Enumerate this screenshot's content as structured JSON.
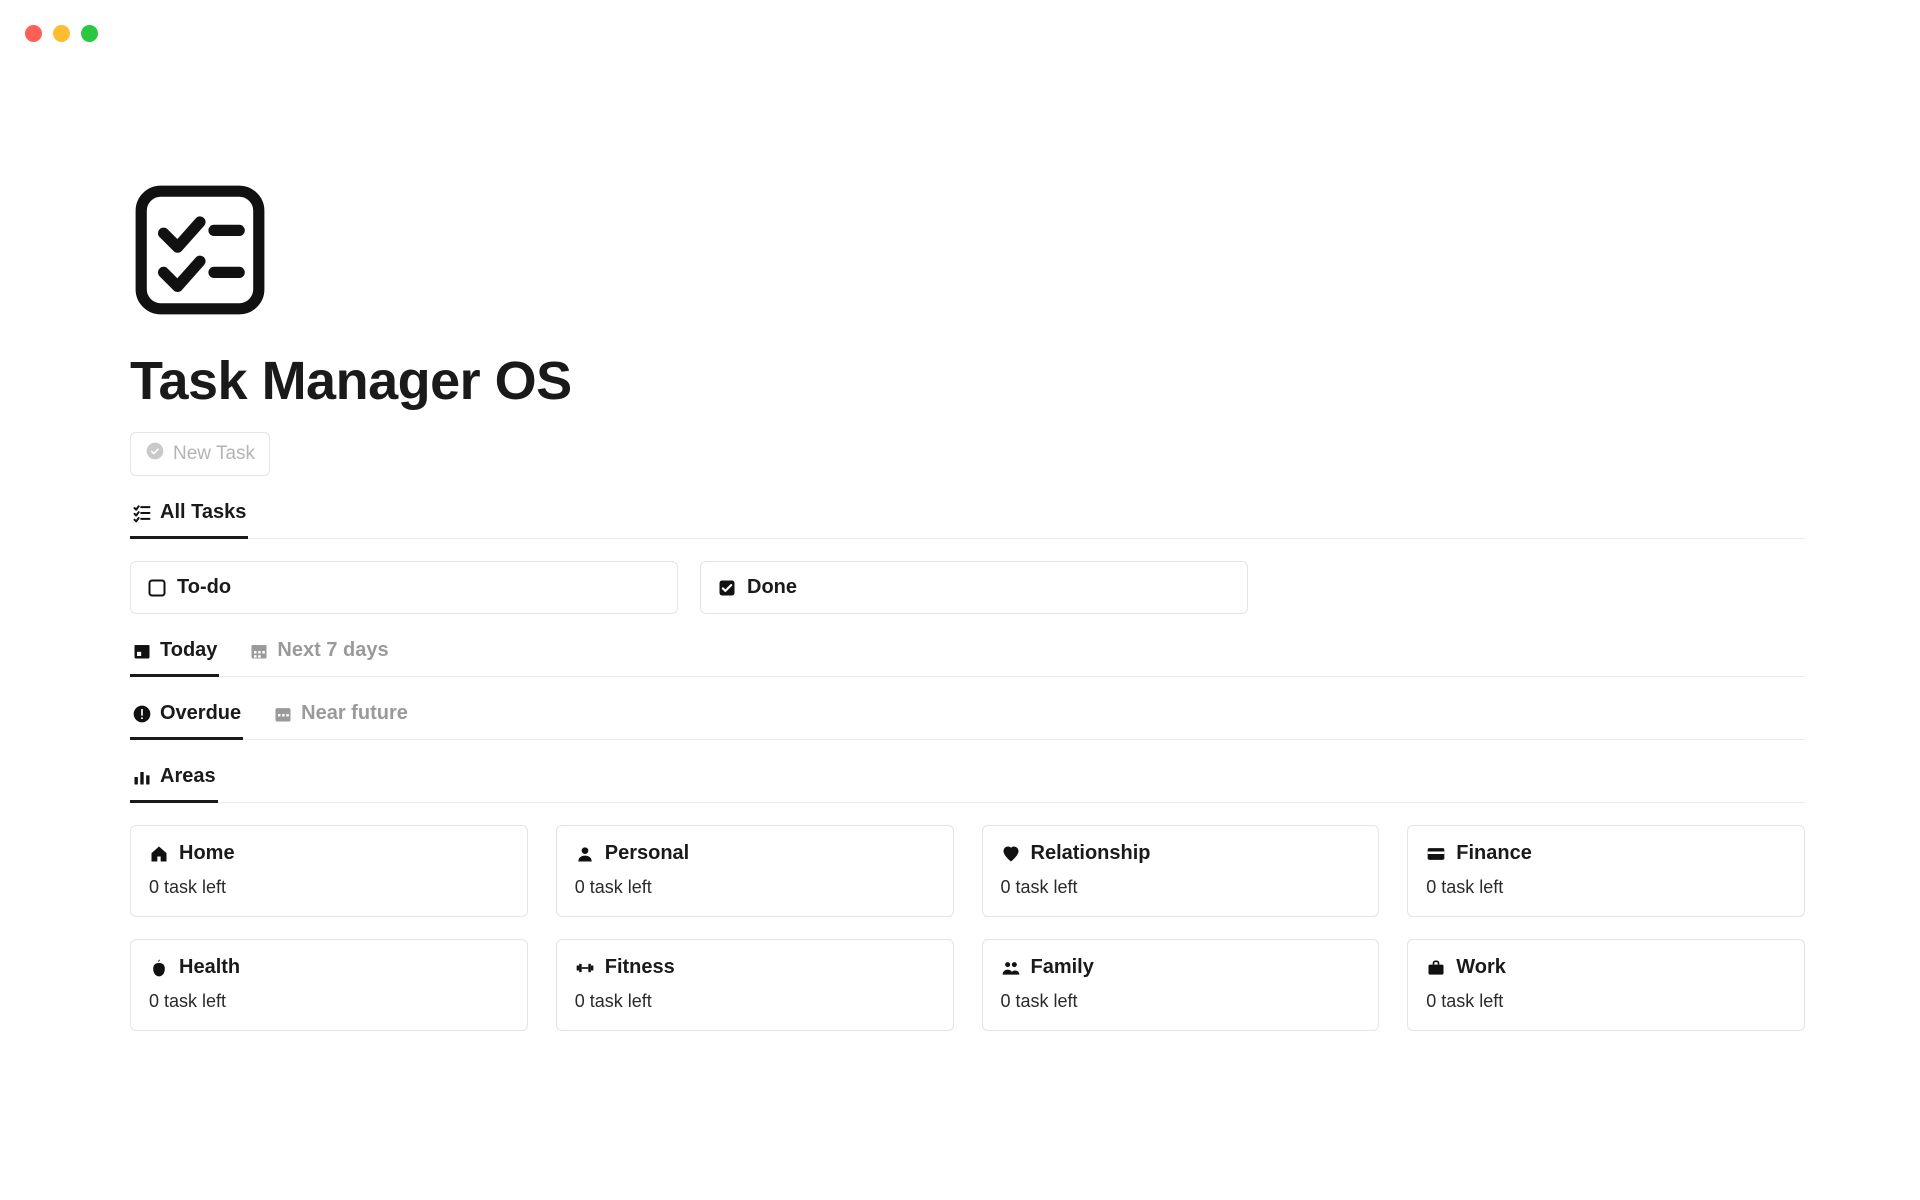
{
  "title": "Task Manager OS",
  "new_task_label": "New Task",
  "tabs_all": {
    "all_tasks": "All Tasks"
  },
  "status": {
    "todo": "To-do",
    "done": "Done"
  },
  "tabs_time": {
    "today": "Today",
    "next7": "Next 7 days"
  },
  "tabs_due": {
    "overdue": "Overdue",
    "near_future": "Near future"
  },
  "tabs_areas": {
    "areas": "Areas"
  },
  "areas": [
    {
      "name": "Home",
      "sub": "0 task left"
    },
    {
      "name": "Personal",
      "sub": "0 task left"
    },
    {
      "name": "Relationship",
      "sub": "0 task left"
    },
    {
      "name": "Finance",
      "sub": "0 task left"
    },
    {
      "name": "Health",
      "sub": "0 task left"
    },
    {
      "name": "Fitness",
      "sub": "0 task left"
    },
    {
      "name": "Family",
      "sub": "0 task left"
    },
    {
      "name": "Work",
      "sub": "0 task left"
    }
  ]
}
